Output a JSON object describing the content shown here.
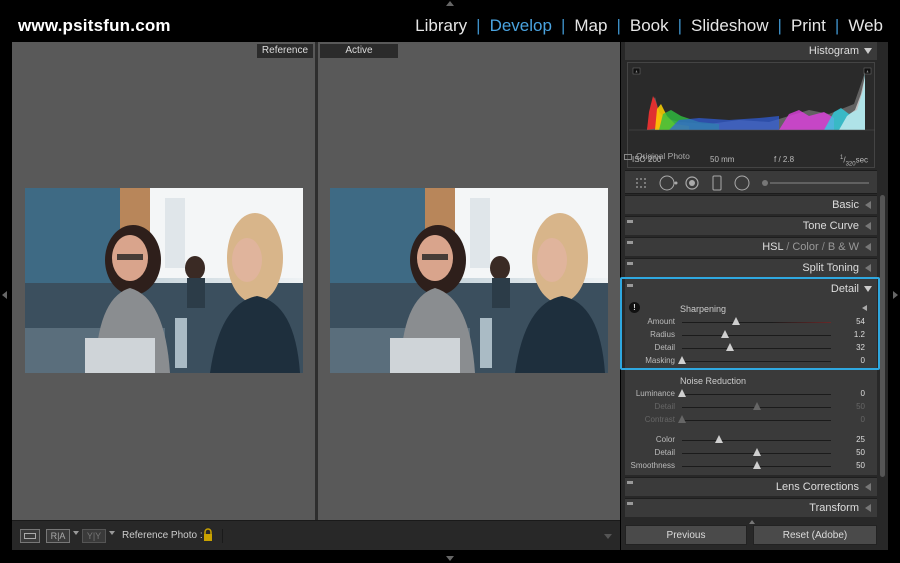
{
  "app": {
    "brand": "www.psitsfun.com"
  },
  "modules": [
    "Library",
    "Develop",
    "Map",
    "Book",
    "Slideshow",
    "Print",
    "Web"
  ],
  "active_module": "Develop",
  "panes": {
    "reference_label": "Reference",
    "active_label": "Active"
  },
  "toolbar": {
    "view_mode_label": "R|A",
    "swap_label": "Y|Y",
    "reference_photo_label": "Reference Photo :"
  },
  "histogram": {
    "title": "Histogram",
    "iso": "ISO 200",
    "focal": "50 mm",
    "aperture": "f / 2.8",
    "shutter_num": "1",
    "shutter_den": "320",
    "shutter_unit": "sec",
    "original_photo": "Original Photo"
  },
  "panels": {
    "basic": "Basic",
    "tone_curve": "Tone Curve",
    "hsl": "HSL",
    "color": "Color",
    "bw": "B & W",
    "split_toning": "Split Toning",
    "detail": "Detail",
    "lens_corrections": "Lens Corrections",
    "transform": "Transform"
  },
  "sharpening": {
    "title": "Sharpening",
    "sliders": [
      {
        "label": "Amount",
        "value": "54",
        "pos": 0.36
      },
      {
        "label": "Radius",
        "value": "1.2",
        "pos": 0.29
      },
      {
        "label": "Detail",
        "value": "32",
        "pos": 0.32
      },
      {
        "label": "Masking",
        "value": "0",
        "pos": 0.0
      }
    ]
  },
  "noise_reduction": {
    "title": "Noise Reduction",
    "sliders": [
      {
        "label": "Luminance",
        "value": "0",
        "pos": 0.0
      },
      {
        "label": "Detail",
        "value": "50",
        "pos": 0.5
      },
      {
        "label": "Contrast",
        "value": "0",
        "pos": 0.0
      },
      {
        "label": "Color",
        "value": "25",
        "pos": 0.25
      },
      {
        "label": "Detail",
        "value": "50",
        "pos": 0.5
      },
      {
        "label": "Smoothness",
        "value": "50",
        "pos": 0.5
      }
    ]
  },
  "buttons": {
    "previous": "Previous",
    "reset": "Reset (Adobe)"
  }
}
